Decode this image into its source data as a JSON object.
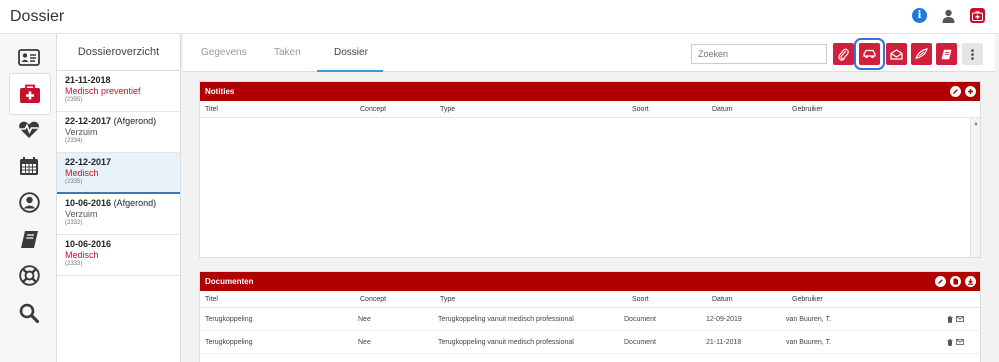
{
  "app": {
    "title": "Dossier"
  },
  "list": {
    "header": "Dossieroverzicht",
    "items": [
      {
        "date": "21-11-2018",
        "status": "",
        "type": "Medisch preventief",
        "id": "(2395)",
        "color": "red"
      },
      {
        "date": "22-12-2017",
        "status": "(Afgerond)",
        "type": "Verzuim",
        "id": "(2334)",
        "color": "grey"
      },
      {
        "date": "22-12-2017",
        "status": "",
        "type": "Medisch",
        "id": "(2335)",
        "color": "red"
      },
      {
        "date": "10-06-2016",
        "status": "(Afgerond)",
        "type": "Verzuim",
        "id": "(2332)",
        "color": "grey"
      },
      {
        "date": "10-06-2016",
        "status": "",
        "type": "Medisch",
        "id": "(2333)",
        "color": "red"
      }
    ]
  },
  "tabs": [
    "Gegevens",
    "Taken",
    "Dossier"
  ],
  "search": {
    "placeholder": "Zoeken"
  },
  "notities": {
    "title": "Notities",
    "columns": [
      "Titel",
      "Concept",
      "Type",
      "Soort",
      "Datum",
      "Gebruiker"
    ]
  },
  "documenten": {
    "title": "Documenten",
    "columns": [
      "Titel",
      "Concept",
      "Type",
      "Soort",
      "Datum",
      "Gebruiker"
    ],
    "rows": [
      [
        "Terugkoppeling",
        "Nee",
        "Terugkoppeling vanuit medisch professional",
        "Document",
        "12-09-2019",
        "van Buuren, T."
      ],
      [
        "Terugkoppeling",
        "Nee",
        "Terugkoppeling vanuit medisch professional",
        "Document",
        "21-11-2018",
        "van Buuren, T."
      ]
    ]
  },
  "colors": {
    "accent": "#d21f3c",
    "panel_header": "#b00000",
    "tab_underline": "#3c9bd4",
    "highlight": "#3c6fd4"
  },
  "icons": {
    "top": [
      "info-icon",
      "user-icon",
      "medical-kit-icon"
    ],
    "sidebar": [
      "id-card-icon",
      "medical-kit-icon",
      "heartbeat-icon",
      "calendar-icon",
      "person-circle-icon",
      "book-icon",
      "lifebuoy-icon",
      "search-icon"
    ],
    "toolbar": [
      "paperclip-icon",
      "car-icon",
      "envelope-open-icon",
      "feather-icon",
      "book-icon",
      "more-vertical-icon"
    ]
  }
}
